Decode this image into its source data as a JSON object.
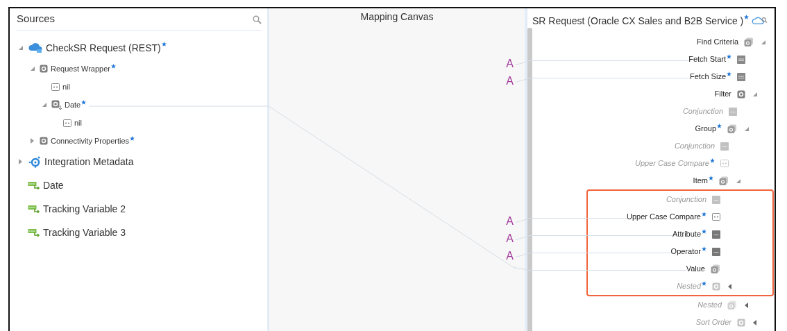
{
  "sources": {
    "title": "Sources",
    "tree": [
      {
        "label": "CheckSR Request (REST)",
        "required": true,
        "kind": "cloud",
        "expanded": true,
        "children": [
          {
            "label": "Request Wrapper",
            "required": true,
            "kind": "object",
            "expanded": true,
            "children": [
              {
                "label": "nil",
                "required": false,
                "kind": "field"
              },
              {
                "label": "Date",
                "required": true,
                "kind": "date-object",
                "expanded": true,
                "mapped": true,
                "children": [
                  {
                    "label": "nil",
                    "required": false,
                    "kind": "field"
                  }
                ]
              }
            ]
          },
          {
            "label": "Connectivity Properties",
            "required": true,
            "kind": "object",
            "expanded": false
          }
        ]
      },
      {
        "label": "Integration Metadata",
        "required": false,
        "kind": "metadata",
        "expanded": false
      },
      {
        "label": "Date",
        "required": false,
        "kind": "variable"
      },
      {
        "label": "Tracking Variable 2",
        "required": false,
        "kind": "variable"
      },
      {
        "label": "Tracking Variable 3",
        "required": false,
        "kind": "variable"
      }
    ]
  },
  "canvas": {
    "title": "Mapping Canvas"
  },
  "target": {
    "title": "SR Request (Oracle CX Sales and B2B Service )",
    "required": true,
    "tree": [
      {
        "label": "Find Criteria",
        "required": false,
        "optional": false,
        "kind": "object-list",
        "expanded": true,
        "children": [
          {
            "label": "Fetch Start",
            "required": true,
            "optional": false,
            "kind": "number",
            "mapping": {
              "function": "A"
            }
          },
          {
            "label": "Fetch Size",
            "required": true,
            "optional": false,
            "kind": "number",
            "mapping": {
              "function": "A"
            }
          },
          {
            "label": "Filter",
            "required": false,
            "optional": false,
            "kind": "object",
            "expanded": true,
            "children": [
              {
                "label": "Conjunction",
                "required": false,
                "optional": true,
                "kind": "string"
              },
              {
                "label": "Group",
                "required": true,
                "optional": false,
                "kind": "object-list",
                "expanded": true,
                "children": [
                  {
                    "label": "Conjunction",
                    "required": false,
                    "optional": true,
                    "kind": "string"
                  },
                  {
                    "label": "Upper Case Compare",
                    "required": true,
                    "optional": true,
                    "kind": "field"
                  },
                  {
                    "label": "Item",
                    "required": true,
                    "optional": false,
                    "kind": "object-list",
                    "expanded": true,
                    "highlighted": true,
                    "children": [
                      {
                        "label": "Conjunction",
                        "required": false,
                        "optional": true,
                        "kind": "string"
                      },
                      {
                        "label": "Upper Case Compare",
                        "required": true,
                        "optional": false,
                        "kind": "field",
                        "mapping": {
                          "function": "A"
                        }
                      },
                      {
                        "label": "Attribute",
                        "required": true,
                        "optional": false,
                        "kind": "string",
                        "mapping": {
                          "function": "A"
                        }
                      },
                      {
                        "label": "Operator",
                        "required": true,
                        "optional": false,
                        "kind": "string",
                        "mapping": {
                          "function": "A"
                        }
                      },
                      {
                        "label": "Value",
                        "required": false,
                        "optional": false,
                        "kind": "object-list",
                        "mapping": {
                          "from_source": true
                        }
                      },
                      {
                        "label": "Nested",
                        "required": true,
                        "optional": true,
                        "kind": "object",
                        "expanded": false
                      }
                    ]
                  }
                ]
              },
              {
                "label": "Nested",
                "required": false,
                "optional": true,
                "kind": "object-list",
                "expanded": false
              }
            ]
          },
          {
            "label": "Sort Order",
            "required": false,
            "optional": true,
            "kind": "object",
            "expanded": false
          }
        ]
      }
    ]
  }
}
